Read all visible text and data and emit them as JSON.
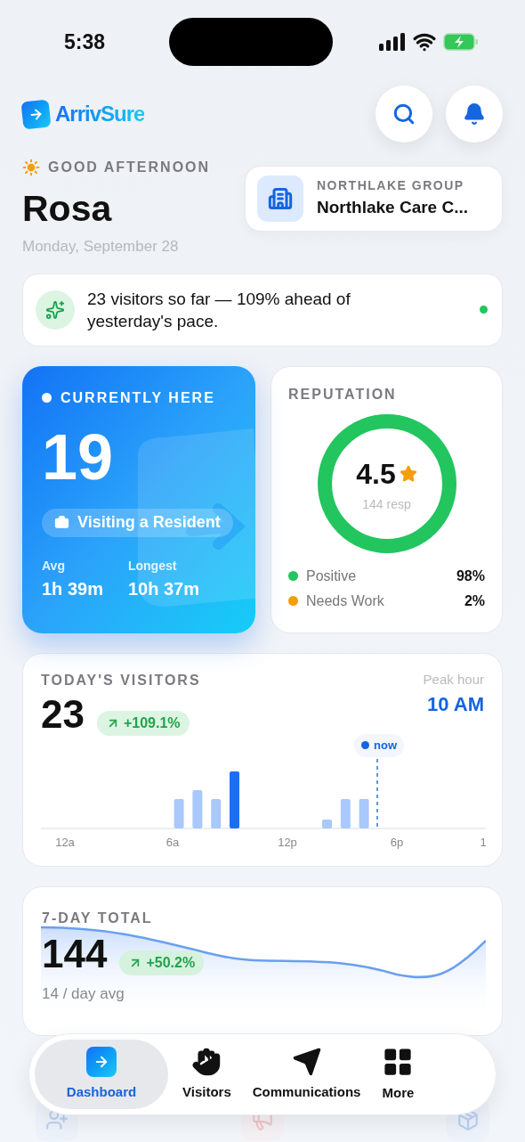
{
  "status_bar": {
    "time": "5:38"
  },
  "header": {
    "brand": "ArrivSure"
  },
  "greeting": {
    "label": "GOOD AFTERNOON",
    "name": "Rosa",
    "date": "Monday, September 28"
  },
  "organization": {
    "group": "NORTHLAKE GROUP",
    "name": "Northlake Care C..."
  },
  "insight": {
    "text": "23 visitors so far — 109% ahead of yesterday's pace."
  },
  "currently_here": {
    "title": "CURRENTLY HERE",
    "count": "19",
    "purpose": "Visiting a Resident",
    "stats": [
      {
        "label": "Avg",
        "value": "1h 39m"
      },
      {
        "label": "Longest",
        "value": "10h 37m"
      }
    ]
  },
  "reputation": {
    "title": "REPUTATION",
    "rating": "4.5",
    "responses": "144 resp",
    "breakdown": [
      {
        "label": "Positive",
        "value": "98%",
        "color": "#22c55e"
      },
      {
        "label": "Needs Work",
        "value": "2%",
        "color": "#f59e0b"
      }
    ]
  },
  "todays_visitors": {
    "title": "TODAY'S VISITORS",
    "count": "23",
    "change": "+109.1%",
    "peak_label": "Peak hour",
    "peak_value": "10 AM",
    "now_label": "now",
    "axis_labels": [
      "12a",
      "6a",
      "12p",
      "6p",
      "1"
    ]
  },
  "seven_day": {
    "title": "7-DAY TOTAL",
    "count": "144",
    "change": "+50.2%",
    "average": "14 / day avg"
  },
  "tab_bar": [
    {
      "label": "Dashboard",
      "selected": true
    },
    {
      "label": "Visitors",
      "selected": false
    },
    {
      "label": "Communications",
      "selected": false
    },
    {
      "label": "More",
      "selected": false
    }
  ]
}
